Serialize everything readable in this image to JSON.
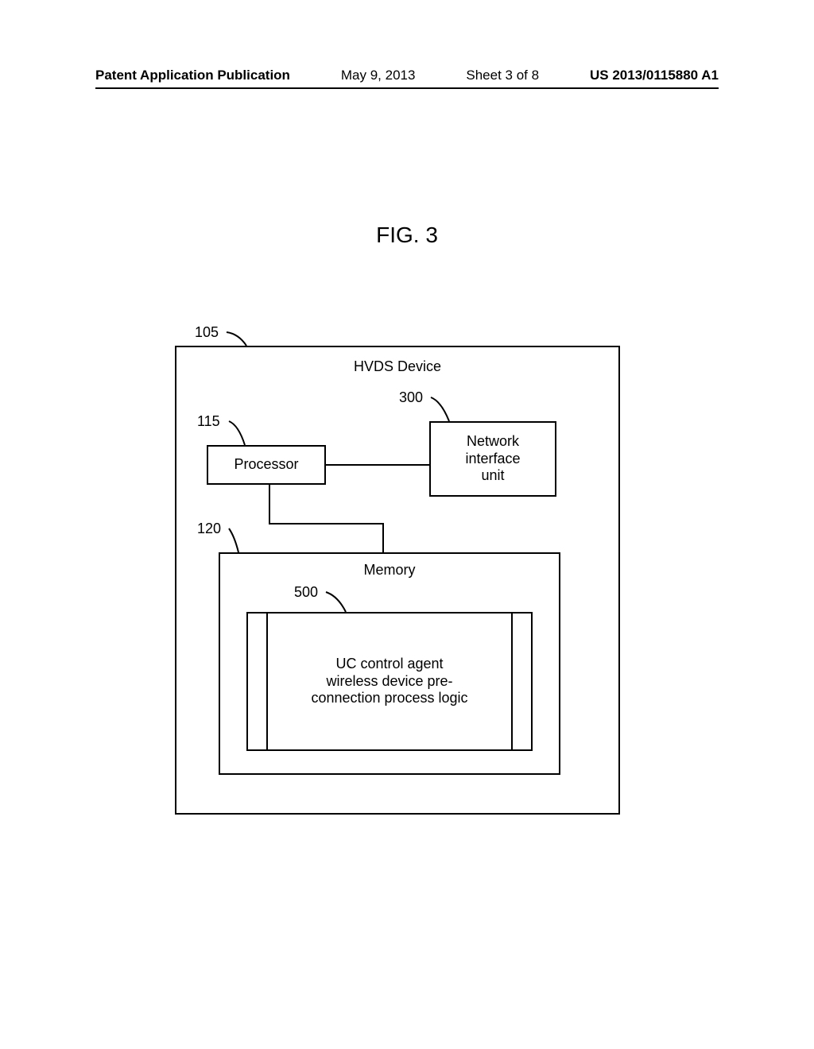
{
  "header": {
    "publication": "Patent Application Publication",
    "date": "May 9, 2013",
    "sheet": "Sheet 3 of 8",
    "number": "US 2013/0115880 A1"
  },
  "figure_label": "FIG. 3",
  "refs": {
    "device": "105",
    "processor": "115",
    "memory": "120",
    "network": "300",
    "logic": "500"
  },
  "blocks": {
    "device_title": "HVDS Device",
    "processor": "Processor",
    "network_l1": "Network",
    "network_l2": "interface",
    "network_l3": "unit",
    "memory": "Memory",
    "logic_l1": "UC control agent",
    "logic_l2": "wireless device pre-",
    "logic_l3": "connection process logic"
  }
}
